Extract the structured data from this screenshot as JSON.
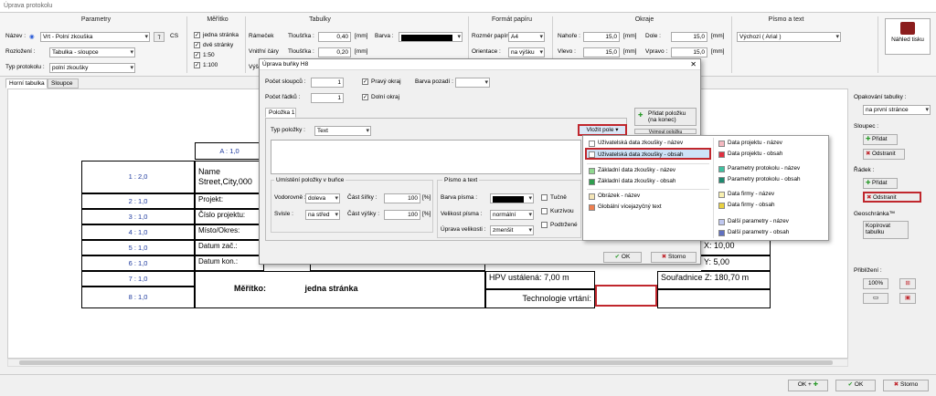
{
  "window": {
    "title": "Úprava protokolu"
  },
  "ribbon": {
    "parametry": {
      "title": "Parametry",
      "nazev_label": "Název :",
      "nazev_value": "Vrt - Polní zkouška",
      "lang": "CS",
      "rozlozeni_label": "Rozložení :",
      "rozlozeni_value": "Tabulka - sloupce",
      "typ_label": "Typ protokolu :",
      "typ_value": "polní zkoušky"
    },
    "meritko": {
      "title": "Měřítko",
      "items": [
        "jedna stránka",
        "dvě stránky",
        "1:50",
        "1:100"
      ]
    },
    "tabulky": {
      "title": "Tabulky",
      "ramecek_label": "Rámeček",
      "tloustka_label": "Tloušťka :",
      "ramecek_value": "0,40",
      "unit": "[mm]",
      "barva_label": "Barva :",
      "vnitrni_label": "Vnitřní čáry",
      "vnitrni_value": "0,20",
      "vys_label": "Výš"
    },
    "format": {
      "title": "Formát papíru",
      "rozmer_label": "Rozměr papíru :",
      "rozmer_value": "A4",
      "orientace_label": "Orientace :",
      "orientace_value": "na výšku"
    },
    "okraje": {
      "title": "Okraje",
      "nahore_label": "Nahoře :",
      "nahore_value": "15,0",
      "dole_label": "Dole :",
      "dole_value": "15,0",
      "vlevo_label": "Vlevo :",
      "vlevo_value": "15,0",
      "vpravo_label": "Vpravo :",
      "vpravo_value": "15,0",
      "unit": "[mm]"
    },
    "pismo": {
      "title": "Písmo a text",
      "value": "Výchozí ( Arial )"
    },
    "preview": "Náhled tisku"
  },
  "tabs": [
    "Horní tabulka",
    "Sloupce"
  ],
  "table": {
    "header_cell": "A : 1,0",
    "rows": [
      "1 : 2,0",
      "2 : 1,0",
      "3 : 1,0",
      "4 : 1,0",
      "5 : 1,0",
      "6 : 1,0",
      "7 : 1,0",
      "8 : 1,0"
    ],
    "name_text": "Name",
    "address_text": "Street,City,000",
    "projekt": "Projekt:",
    "cislo": "Číslo projektu:",
    "misto": "Místo/Okres:",
    "datum_zac": "Datum zač.:",
    "datum_kon": "Datum kon.:",
    "meritko_label": "Měřítko:",
    "meritko_value": "jedna stránka",
    "x_label": "X:",
    "x_value": "10,00",
    "y_label": "Y:",
    "y_value": "5,00",
    "hpv_label": "HPV ustálená:",
    "hpv_value": "7,00 m",
    "souradnice_label": "Souřadnice Z:",
    "souradnice_value": "180,70 m",
    "technologie_label": "Technologie vrtání:",
    "fragments": [
      "E",
      "2",
      "L",
      "8",
      "8"
    ]
  },
  "dialog": {
    "title": "Úprava buňky H8",
    "pocet_sloupcu_label": "Počet sloupců :",
    "pocet_sloupcu_value": "1",
    "pocet_radku_label": "Počet řádků :",
    "pocet_radku_value": "1",
    "pravy_okraj": "Pravý okraj",
    "dolni_okraj": "Dolní okraj",
    "barva_pozadi": "Barva pozadí :",
    "polozka_tab": "Položka 1",
    "pridat_polozku": "Přidat položku (na konec)",
    "vyjmout_polozku": "Vyjmout položku",
    "typ_polozky_label": "Typ položky :",
    "typ_polozky_value": "Text",
    "vlozit_pole": "Vložit pole",
    "umisteni_title": "Umístění položky v buňce",
    "vodorovne_label": "Vodorovně :",
    "vodorovne_value": "doleva",
    "svisle_label": "Svisle :",
    "svisle_value": "na střed",
    "cast_sirky_label": "Část šířky :",
    "cast_sirky_value": "100",
    "cast_vysky_label": "Část výšky :",
    "cast_vysky_value": "100",
    "pct": "[%]",
    "pismo_title": "Písmo a text",
    "barva_pisma_label": "Barva písma :",
    "velikost_label": "Velikost písma :",
    "velikost_value": "normální",
    "uprava_label": "Úprava velikosti :",
    "uprava_value": "zmenšit",
    "tucne": "Tučně",
    "kurzivou": "Kurzívou",
    "podtrzene": "Podtržené",
    "ok": "OK",
    "storno": "Storno"
  },
  "popup": {
    "left": [
      {
        "label": "Uživatelská data zkoušky - název",
        "color": "#ffffff"
      },
      {
        "label": "Uživatelská data zkoušky - obsah",
        "color": "#ffffff"
      },
      {
        "label": "Základní data zkoušky - název",
        "color": "#90d890"
      },
      {
        "label": "Základní data zkoušky - obsah",
        "color": "#2e9e4e"
      },
      {
        "label": "Obrázek - název",
        "color": "#f5e6b8"
      },
      {
        "label": "Globální vícejazyčný text",
        "color": "#f08050"
      }
    ],
    "right": [
      {
        "label": "Data projektu - název",
        "color": "#f4b8c0"
      },
      {
        "label": "Data projektu - obsah",
        "color": "#e03040"
      },
      {
        "label": "Parametry protokolu - název",
        "color": "#40c0a0"
      },
      {
        "label": "Parametry protokolu - obsah",
        "color": "#1e8a70"
      },
      {
        "label": "Data firmy - název",
        "color": "#f8f0b0"
      },
      {
        "label": "Data firmy - obsah",
        "color": "#e8d040"
      },
      {
        "label": "Další parametry - název",
        "color": "#c0c8f0"
      },
      {
        "label": "Další parametry - obsah",
        "color": "#6070c0"
      }
    ]
  },
  "right_panel": {
    "opakovani_label": "Opakování tabulky :",
    "opakovani_value": "na první stránce",
    "sloupec_label": "Sloupec :",
    "radek_label": "Řádek :",
    "pridat": "Přidat",
    "odstranit": "Odstranit",
    "geoschranka_label": "Geoschránka™",
    "kopirovat": "Kopírovat tabulku",
    "priblizeni_label": "Přiblížení :",
    "zoom": "100%"
  },
  "status": {
    "ok_plus": "OK +",
    "ok": "OK",
    "storno": "Storno"
  }
}
